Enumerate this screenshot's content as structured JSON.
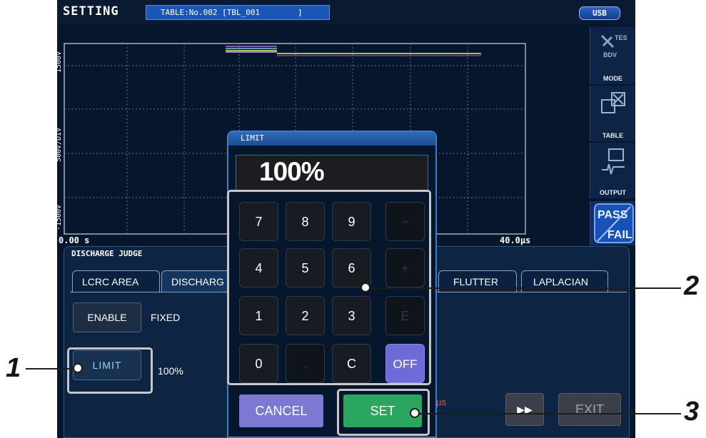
{
  "topbar": {
    "title": "SETTING",
    "table_text": "TABLE:No.002 [TBL_001        ]",
    "usb_label": "USB"
  },
  "waveform": {
    "y_top_label": "1500V",
    "y_mid_label": "500V/DIV",
    "y_bottom_label": "-1500V",
    "x_start_label": "0.00 s",
    "x_end_label": "40.0µs"
  },
  "sidebar": {
    "mode_label": "MODE",
    "mode_icon_text_top": "TEST",
    "mode_icon_text_bottom": "BDV",
    "table_label": "TABLE",
    "output_label": "OUTPUT",
    "pass_label": "PASS",
    "fail_label": "FAIL"
  },
  "judge_panel": {
    "header": "DISCHARGE JUDGE",
    "tabs": [
      {
        "label": "LCRC AREA"
      },
      {
        "label": "DISCHARG"
      },
      {
        "label": "FLUTTER"
      },
      {
        "label": "LAPLACIAN"
      }
    ],
    "enable_label": "ENABLE",
    "enable_value": "FIXED",
    "limit_label": "LIMIT",
    "limit_value": "100%",
    "partial_unit": "µs",
    "exit_label": "EXIT",
    "ff_icon": "fast-forward-icon"
  },
  "dialog": {
    "title": "LIMIT",
    "display_value": "100%",
    "keys": [
      "7",
      "8",
      "9",
      "−",
      "4",
      "5",
      "6",
      "+",
      "1",
      "2",
      "3",
      "E",
      "0",
      ".",
      "C",
      "OFF"
    ],
    "cancel_label": "CANCEL",
    "set_label": "SET"
  },
  "callouts": [
    "1",
    "2",
    "3"
  ],
  "colors": {
    "screen_bg": "#06162c",
    "set_green": "#2aa65e",
    "cancel_purple": "#7b79d3",
    "off_purple": "#6e6bd8",
    "trace_yellow": "#f2f06a"
  }
}
